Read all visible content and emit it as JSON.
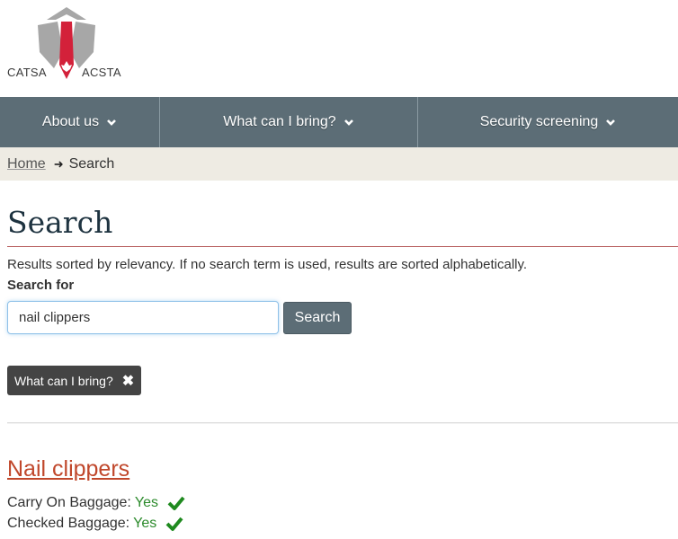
{
  "logo": {
    "left_text": "CATSA",
    "right_text": "ACSTA",
    "icon": "catsa-shield-maple-leaf-logo"
  },
  "nav": {
    "items": [
      {
        "label": "About us",
        "icon": "chevron-down-icon"
      },
      {
        "label": "What can I bring?",
        "icon": "chevron-down-icon"
      },
      {
        "label": "Security screening",
        "icon": "chevron-down-icon"
      }
    ]
  },
  "breadcrumb": {
    "home": "Home",
    "arrow": "➜",
    "current": "Search"
  },
  "page": {
    "title": "Search",
    "intro": "Results sorted by relevancy. If no search term is used, results are sorted alphabetically.",
    "search_label": "Search for",
    "search_value": "nail clippers",
    "search_button": "Search"
  },
  "filters": [
    {
      "label": "What can I bring?",
      "remove_icon": "close-icon"
    }
  ],
  "results": [
    {
      "title": "Nail clippers",
      "carry_on_label": "Carry On Baggage:",
      "carry_on_value": "Yes",
      "checked_label": "Checked Baggage:",
      "checked_value": "Yes"
    }
  ],
  "colors": {
    "nav_bg": "#5c6d76",
    "breadcrumb_bg": "#eeebe3",
    "title_rule": "#b55a5a",
    "result_link": "#c0472b",
    "yes_green": "#2b8a2b",
    "tag_bg": "#444444"
  }
}
